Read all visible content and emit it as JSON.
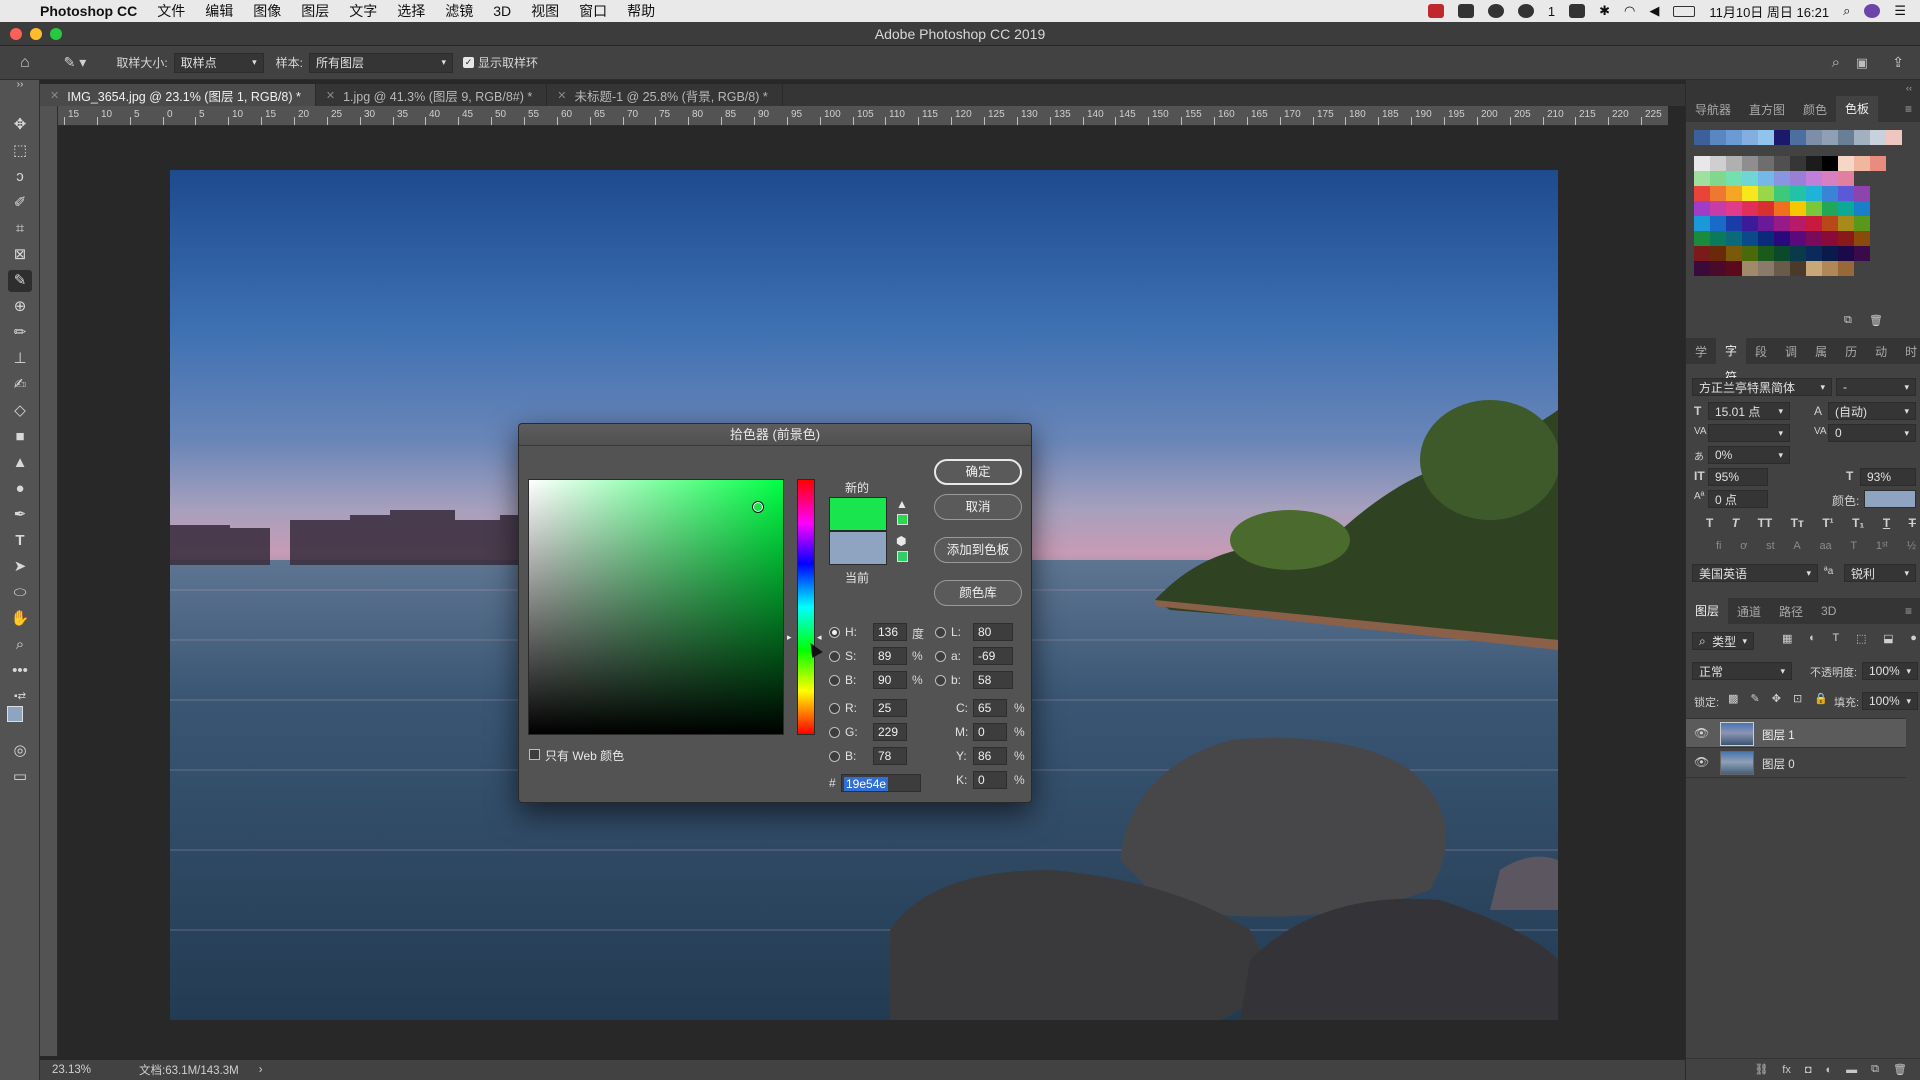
{
  "menubar": {
    "app": "Photoshop CC",
    "items": [
      "文件",
      "编辑",
      "图像",
      "图层",
      "文字",
      "选择",
      "滤镜",
      "3D",
      "视图",
      "窗口",
      "帮助"
    ],
    "status_right": {
      "badge": "1",
      "datetime": "11月10日 周日 16:21"
    }
  },
  "window": {
    "title": "Adobe Photoshop CC 2019"
  },
  "options": {
    "sample_size_label": "取样大小:",
    "sample_size_value": "取样点",
    "sample_label": "样本:",
    "sample_value": "所有图层",
    "show_ring_label": "显示取样环"
  },
  "tabs": [
    {
      "label": "IMG_3654.jpg @ 23.1% (图层 1, RGB/8) *"
    },
    {
      "label": "1.jpg @ 41.3% (图层 9, RGB/8#) *"
    },
    {
      "label": "未标题-1 @ 25.8% (背景, RGB/8) *"
    }
  ],
  "ruler": {
    "h_ticks": [
      "15",
      "10",
      "5",
      "0",
      "5",
      "10",
      "15",
      "20",
      "25",
      "30",
      "35",
      "40",
      "45",
      "50",
      "55",
      "60",
      "65",
      "70",
      "75",
      "80",
      "85",
      "90",
      "95",
      "100",
      "105",
      "110",
      "115",
      "120",
      "125",
      "130",
      "135",
      "140",
      "145",
      "150",
      "155",
      "160",
      "165",
      "170",
      "175",
      "180",
      "185",
      "190",
      "195",
      "200",
      "205",
      "210",
      "215",
      "220",
      "225"
    ]
  },
  "status": {
    "zoom": "23.13%",
    "doc": "文档:63.1M/143.3M"
  },
  "dialog": {
    "title": "拾色器 (前景色)",
    "new_label": "新的",
    "current_label": "当前",
    "ok": "确定",
    "cancel": "取消",
    "add_swatch": "添加到色板",
    "color_libraries": "颜色库",
    "web_only": "只有 Web 颜色",
    "new_color": "#19e54e",
    "current_color": "#8ea4c0",
    "hue_base": "#00ff44",
    "fields": {
      "H": "136",
      "S": "89",
      "B": "90",
      "R": "25",
      "G": "229",
      "B2": "78",
      "L": "80",
      "a": "-69",
      "b": "58",
      "C": "65",
      "M": "0",
      "Y": "86",
      "K": "0",
      "hex": "19e54e"
    },
    "units": {
      "deg": "度",
      "pct": "%"
    }
  },
  "panels": {
    "top_tabs": [
      "导航器",
      "直方图",
      "颜色",
      "色板"
    ],
    "char_tabs": [
      "学",
      "字符",
      "段",
      "调",
      "属",
      "历",
      "动",
      "时"
    ],
    "font_family": "方正兰亭特黑简体",
    "font_style": "-",
    "font_size": "15.01 点",
    "leading": "(自动)",
    "kerning": "",
    "tracking": "0",
    "tsume": "0%",
    "vscale": "95%",
    "hscale": "93%",
    "baseline": "0 点",
    "color_label": "颜色:",
    "language": "美国英语",
    "antialias": "锐利",
    "layer_tabs": [
      "图层",
      "通道",
      "路径",
      "3D"
    ],
    "kind_label": "类型",
    "blend_mode": "正常",
    "opacity_label": "不透明度:",
    "opacity": "100%",
    "lock_label": "锁定:",
    "fill_label": "填充:",
    "fill": "100%",
    "layers": [
      {
        "name": "图层 1"
      },
      {
        "name": "图层 0"
      }
    ]
  }
}
